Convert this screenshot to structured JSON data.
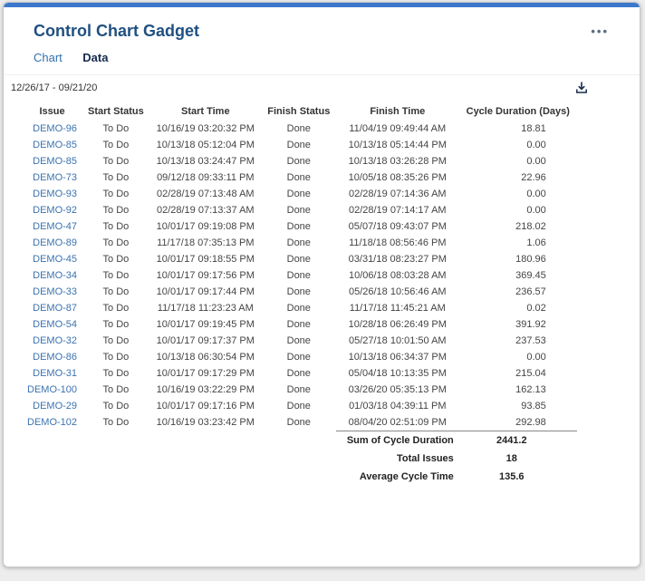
{
  "gadget": {
    "title": "Control Chart Gadget",
    "menu_icon_glyph": "•••"
  },
  "colors": {
    "accent": "#3b78cb",
    "title": "#205081",
    "issue_link": "#3b73af",
    "tab_link": "#3572b0"
  },
  "tabs": [
    {
      "label": "Chart",
      "active": false
    },
    {
      "label": "Data",
      "active": true
    }
  ],
  "toolbar": {
    "date_range": "12/26/17 - 09/21/20",
    "export_icon": "download-icon"
  },
  "table": {
    "columns": [
      "Issue",
      "Start Status",
      "Start Time",
      "Finish Status",
      "Finish Time",
      "Cycle Duration (Days)"
    ],
    "rows": [
      {
        "issue": "DEMO-96",
        "start_status": "To Do",
        "start_time": "10/16/19 03:20:32 PM",
        "finish_status": "Done",
        "finish_time": "11/04/19 09:49:44 AM",
        "cycle_duration": "18.81"
      },
      {
        "issue": "DEMO-85",
        "start_status": "To Do",
        "start_time": "10/13/18 05:12:04 PM",
        "finish_status": "Done",
        "finish_time": "10/13/18 05:14:44 PM",
        "cycle_duration": "0.00"
      },
      {
        "issue": "DEMO-85",
        "start_status": "To Do",
        "start_time": "10/13/18 03:24:47 PM",
        "finish_status": "Done",
        "finish_time": "10/13/18 03:26:28 PM",
        "cycle_duration": "0.00"
      },
      {
        "issue": "DEMO-73",
        "start_status": "To Do",
        "start_time": "09/12/18 09:33:11 PM",
        "finish_status": "Done",
        "finish_time": "10/05/18 08:35:26 PM",
        "cycle_duration": "22.96"
      },
      {
        "issue": "DEMO-93",
        "start_status": "To Do",
        "start_time": "02/28/19 07:13:48 AM",
        "finish_status": "Done",
        "finish_time": "02/28/19 07:14:36 AM",
        "cycle_duration": "0.00"
      },
      {
        "issue": "DEMO-92",
        "start_status": "To Do",
        "start_time": "02/28/19 07:13:37 AM",
        "finish_status": "Done",
        "finish_time": "02/28/19 07:14:17 AM",
        "cycle_duration": "0.00"
      },
      {
        "issue": "DEMO-47",
        "start_status": "To Do",
        "start_time": "10/01/17 09:19:08 PM",
        "finish_status": "Done",
        "finish_time": "05/07/18 09:43:07 PM",
        "cycle_duration": "218.02"
      },
      {
        "issue": "DEMO-89",
        "start_status": "To Do",
        "start_time": "11/17/18 07:35:13 PM",
        "finish_status": "Done",
        "finish_time": "11/18/18 08:56:46 PM",
        "cycle_duration": "1.06"
      },
      {
        "issue": "DEMO-45",
        "start_status": "To Do",
        "start_time": "10/01/17 09:18:55 PM",
        "finish_status": "Done",
        "finish_time": "03/31/18 08:23:27 PM",
        "cycle_duration": "180.96"
      },
      {
        "issue": "DEMO-34",
        "start_status": "To Do",
        "start_time": "10/01/17 09:17:56 PM",
        "finish_status": "Done",
        "finish_time": "10/06/18 08:03:28 AM",
        "cycle_duration": "369.45"
      },
      {
        "issue": "DEMO-33",
        "start_status": "To Do",
        "start_time": "10/01/17 09:17:44 PM",
        "finish_status": "Done",
        "finish_time": "05/26/18 10:56:46 AM",
        "cycle_duration": "236.57"
      },
      {
        "issue": "DEMO-87",
        "start_status": "To Do",
        "start_time": "11/17/18 11:23:23 AM",
        "finish_status": "Done",
        "finish_time": "11/17/18 11:45:21 AM",
        "cycle_duration": "0.02"
      },
      {
        "issue": "DEMO-54",
        "start_status": "To Do",
        "start_time": "10/01/17 09:19:45 PM",
        "finish_status": "Done",
        "finish_time": "10/28/18 06:26:49 PM",
        "cycle_duration": "391.92"
      },
      {
        "issue": "DEMO-32",
        "start_status": "To Do",
        "start_time": "10/01/17 09:17:37 PM",
        "finish_status": "Done",
        "finish_time": "05/27/18 10:01:50 AM",
        "cycle_duration": "237.53"
      },
      {
        "issue": "DEMO-86",
        "start_status": "To Do",
        "start_time": "10/13/18 06:30:54 PM",
        "finish_status": "Done",
        "finish_time": "10/13/18 06:34:37 PM",
        "cycle_duration": "0.00"
      },
      {
        "issue": "DEMO-31",
        "start_status": "To Do",
        "start_time": "10/01/17 09:17:29 PM",
        "finish_status": "Done",
        "finish_time": "05/04/18 10:13:35 PM",
        "cycle_duration": "215.04"
      },
      {
        "issue": "DEMO-100",
        "start_status": "To Do",
        "start_time": "10/16/19 03:22:29 PM",
        "finish_status": "Done",
        "finish_time": "03/26/20 05:35:13 PM",
        "cycle_duration": "162.13"
      },
      {
        "issue": "DEMO-29",
        "start_status": "To Do",
        "start_time": "10/01/17 09:17:16 PM",
        "finish_status": "Done",
        "finish_time": "01/03/18 04:39:11 PM",
        "cycle_duration": "93.85"
      },
      {
        "issue": "DEMO-102",
        "start_status": "To Do",
        "start_time": "10/16/19 03:23:42 PM",
        "finish_status": "Done",
        "finish_time": "08/04/20 02:51:09 PM",
        "cycle_duration": "292.98"
      }
    ],
    "summary": [
      {
        "label": "Sum of Cycle Duration",
        "value": "2441.2"
      },
      {
        "label": "Total Issues",
        "value": "18"
      },
      {
        "label": "Average Cycle Time",
        "value": "135.6"
      }
    ]
  }
}
